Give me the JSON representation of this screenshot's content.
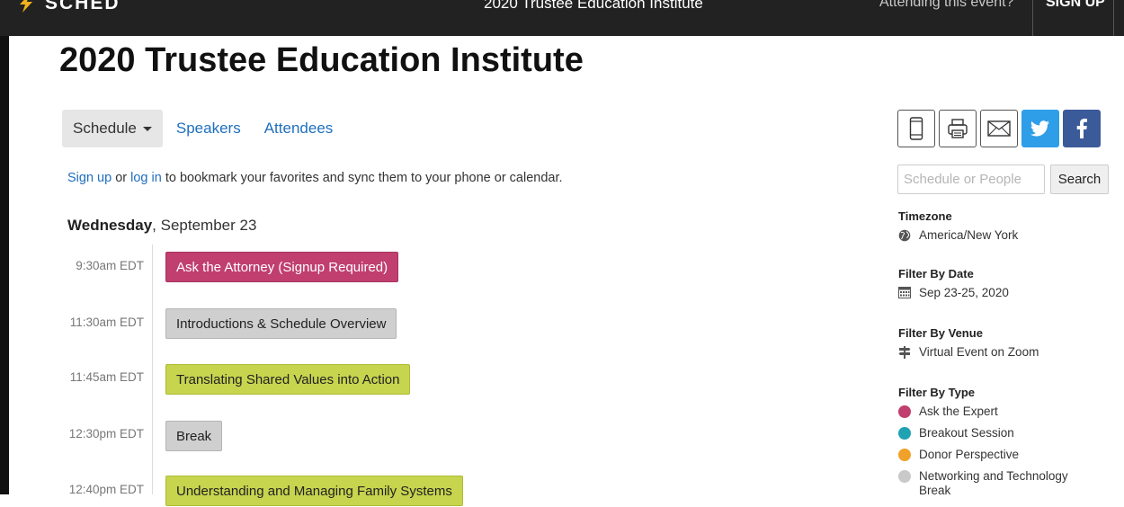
{
  "topbar": {
    "logo_text": "SCHED",
    "event_title": "2020 Trustee Education Institute",
    "attending_prompt": "Attending this event?",
    "signup_label": "SIGN UP"
  },
  "page_title": "2020 Trustee Education Institute",
  "tabs": {
    "schedule": "Schedule",
    "speakers": "Speakers",
    "attendees": "Attendees"
  },
  "signin": {
    "signup_link": "Sign up",
    "or_text": " or ",
    "login_link": "log in",
    "rest_text": " to bookmark your favorites and sync them to your phone or calendar."
  },
  "day": {
    "weekday": "Wednesday",
    "date": ", September 23"
  },
  "sessions": [
    {
      "time": "9:30am EDT",
      "title": "Ask the Attorney (Signup Required)",
      "color": "#c03f6e"
    },
    {
      "time": "11:30am EDT",
      "title": "Introductions & Schedule Overview",
      "color": "#cfcfcf"
    },
    {
      "time": "11:45am EDT",
      "title": "Translating Shared Values into Action",
      "color": "#c7d44e"
    },
    {
      "time": "12:30pm EDT",
      "title": "Break",
      "color": "#cfcfcf"
    },
    {
      "time": "12:40pm EDT",
      "title": "Understanding and Managing Family Systems",
      "color": "#c7d44e"
    }
  ],
  "share_icons": [
    "mobile-icon",
    "print-icon",
    "email-icon",
    "twitter-icon",
    "facebook-icon"
  ],
  "search": {
    "placeholder": "Schedule or People",
    "button": "Search"
  },
  "filters": {
    "timezone_title": "Timezone",
    "timezone_value": "America/New York",
    "date_title": "Filter By Date",
    "date_value": "Sep 23-25, 2020",
    "venue_title": "Filter By Venue",
    "venue_value": "Virtual Event on Zoom",
    "type_title": "Filter By Type",
    "types": [
      {
        "label": "Ask the Expert",
        "color": "#c03f6e"
      },
      {
        "label": "Breakout Session",
        "color": "#1fa2b1"
      },
      {
        "label": "Donor Perspective",
        "color": "#efa12a"
      },
      {
        "label": "Networking and Technology Break",
        "color": "#c9c9c9"
      }
    ]
  }
}
